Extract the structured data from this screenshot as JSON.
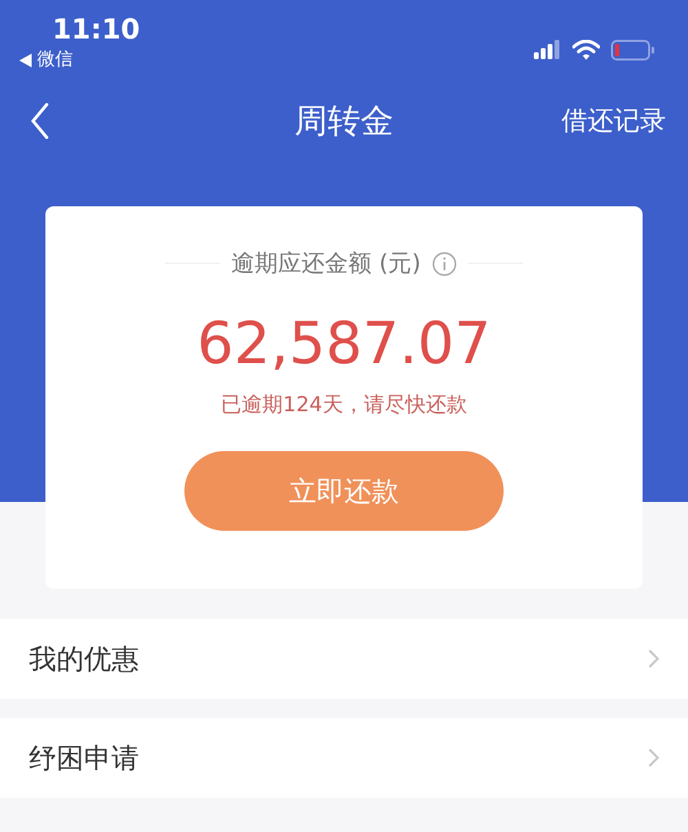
{
  "status_bar": {
    "time": "11:10",
    "back_app": "微信"
  },
  "nav": {
    "title": "周转金",
    "action": "借还记录"
  },
  "card": {
    "label": "逾期应还金额 (元)",
    "amount": "62,587.07",
    "notice": "已逾期124天，请尽快还款",
    "button": "立即还款"
  },
  "menu": [
    {
      "label": "我的优惠"
    },
    {
      "label": "纾困申请"
    }
  ]
}
